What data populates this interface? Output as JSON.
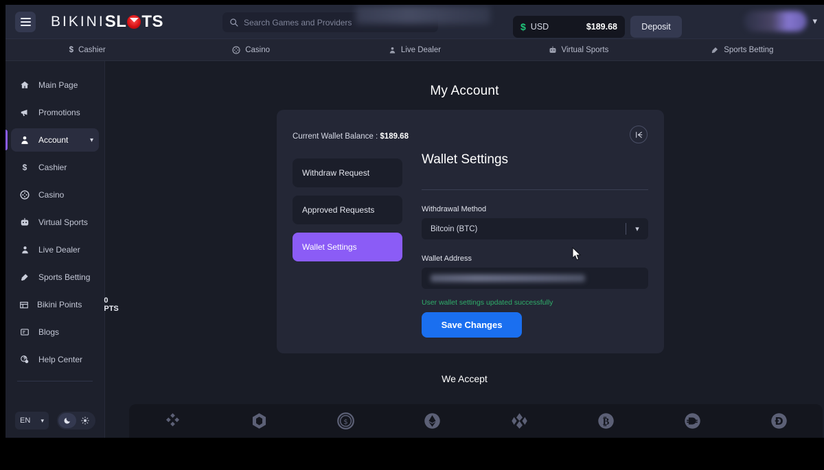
{
  "header": {
    "menu_icon": "hamburger-icon",
    "logo": {
      "part1": "BIKINI",
      "part2_a": "SL",
      "part2_b": "TS"
    },
    "search": {
      "placeholder": "Search Games and Providers",
      "value": "",
      "icon": "search-icon"
    },
    "wallet": {
      "currency": "USD",
      "amount": "$189.68",
      "icon": "dollar-icon"
    },
    "deposit_label": "Deposit",
    "user": {
      "name_redacted": "",
      "chevron": "chevron-down-icon"
    }
  },
  "navbar": {
    "items": [
      {
        "label": "Cashier",
        "icon": "dollar-icon"
      },
      {
        "label": "Casino",
        "icon": "casino-chip-icon"
      },
      {
        "label": "Live Dealer",
        "icon": "dealer-icon"
      },
      {
        "label": "Virtual Sports",
        "icon": "virtual-sports-icon"
      },
      {
        "label": "Sports Betting",
        "icon": "sports-betting-icon"
      }
    ]
  },
  "sidebar": {
    "items": [
      {
        "label": "Main Page",
        "icon": "home-icon",
        "active": false
      },
      {
        "label": "Promotions",
        "icon": "megaphone-icon",
        "active": false
      },
      {
        "label": "Account",
        "icon": "user-icon",
        "active": true,
        "chevron": "chevron-down-icon"
      },
      {
        "label": "Cashier",
        "icon": "dollar-icon",
        "active": false
      },
      {
        "label": "Casino",
        "icon": "casino-chip-icon",
        "active": false
      },
      {
        "label": "Virtual Sports",
        "icon": "virtual-sports-icon",
        "active": false
      },
      {
        "label": "Live Dealer",
        "icon": "dealer-icon",
        "active": false
      },
      {
        "label": "Sports Betting",
        "icon": "sports-betting-icon",
        "active": false
      },
      {
        "label": "Bikini Points",
        "icon": "points-icon",
        "active": false,
        "value": "0 PTS"
      },
      {
        "label": "Blogs",
        "icon": "blog-icon",
        "active": false
      },
      {
        "label": "Help Center",
        "icon": "help-icon",
        "active": false
      }
    ],
    "language": {
      "value": "EN",
      "chevron": "chevron-down-icon"
    },
    "theme": {
      "dark_icon": "moon-icon",
      "light_icon": "sun-icon",
      "active": "dark"
    }
  },
  "main": {
    "page_title": "My Account",
    "balance_label": "Current Wallet Balance : ",
    "balance_value": "$189.68",
    "collapse_icon": "collapse-left-icon",
    "tabs": [
      {
        "label": "Withdraw Request",
        "active": false
      },
      {
        "label": "Approved Requests",
        "active": false
      },
      {
        "label": "Wallet Settings",
        "active": true
      }
    ],
    "settings": {
      "title": "Wallet Settings",
      "method_label": "Withdrawal Method",
      "method_value": "Bitcoin (BTC)",
      "method_chevron": "chevron-down-icon",
      "address_label": "Wallet Address",
      "address_value": "",
      "success_message": "User wallet settings updated successfully",
      "save_label": "Save Changes"
    },
    "we_accept_title": "We Accept",
    "coins": [
      {
        "name": "binance-coin-icon"
      },
      {
        "name": "chainlink-icon"
      },
      {
        "name": "usd-coin-icon"
      },
      {
        "name": "ethereum-icon"
      },
      {
        "name": "dash-icon"
      },
      {
        "name": "bitcoin-icon"
      },
      {
        "name": "dai-icon"
      },
      {
        "name": "dogecoin-icon"
      }
    ]
  },
  "colors": {
    "accent_purple": "#8b5cf6",
    "accent_blue": "#1a6ff0",
    "success_green": "#2fae6a",
    "logo_red": "#d40f12",
    "page_bg": "#191c26",
    "card_bg": "#242736"
  }
}
